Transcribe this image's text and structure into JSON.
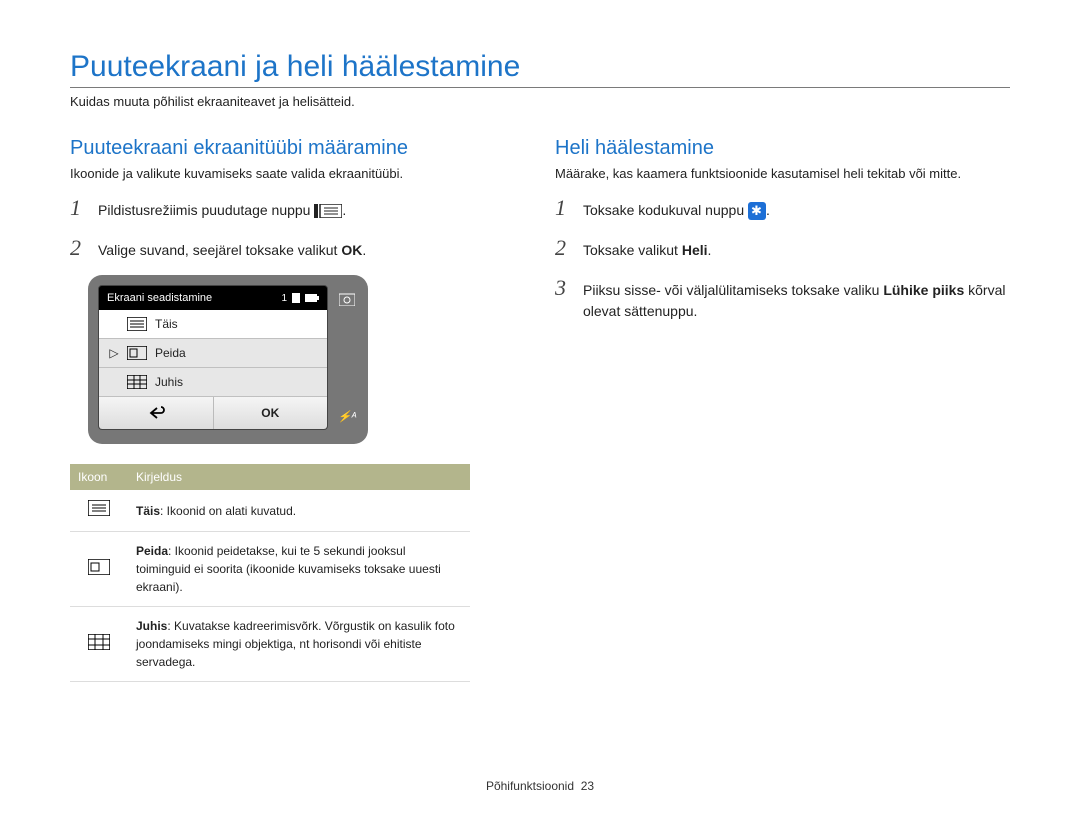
{
  "title": "Puuteekraani ja heli häälestamine",
  "subtitle": "Kuidas muuta põhilist ekraaniteavet ja helisätteid.",
  "left": {
    "heading": "Puuteekraani ekraanitüübi määramine",
    "lead": "Ikoonide ja valikute kuvamiseks saate valida ekraanitüübi.",
    "steps": {
      "s1": "Pildistusrežiimis puudutage nuppu ",
      "s1_after": ".",
      "s2": "Valige suvand, seejärel toksake valikut ",
      "s2_after": "."
    },
    "device": {
      "title": "Ekraani seadistamine",
      "status_num": "1",
      "items": {
        "i1": "Täis",
        "i2": "Peida",
        "i3": "Juhis"
      },
      "ok_label": "OK"
    },
    "table": {
      "h1": "Ikoon",
      "h2": "Kirjeldus",
      "r1_term": "Täis",
      "r1_body": ": Ikoonid on alati kuvatud.",
      "r2_term": "Peida",
      "r2_body": ": Ikoonid peidetakse, kui te 5 sekundi jooksul toiminguid ei soorita (ikoonide kuvamiseks toksake uuesti ekraani).",
      "r3_term": "Juhis",
      "r3_body": ": Kuvatakse kadreerimisvõrk. Võrgustik on kasulik foto joondamiseks mingi objektiga, nt horisondi või ehitiste servadega."
    }
  },
  "right": {
    "heading": "Heli häälestamine",
    "lead": "Määrake, kas kaamera funktsioonide kasutamisel heli tekitab või mitte.",
    "steps": {
      "s1": "Toksake kodukuval nuppu ",
      "s1_after": ".",
      "s2_pre": "Toksake valikut ",
      "s2_bold": "Heli",
      "s2_after": ".",
      "s3_pre": "Piiksu sisse- või väljalülitamiseks toksake valiku ",
      "s3_bold": "Lühike piiks",
      "s3_after": " kõrval olevat sättenuppu."
    }
  },
  "footer": {
    "label": "Põhifunktsioonid",
    "page_no": "23"
  },
  "ok_glyph": "OK",
  "flash_glyph": "⚡ᴬ"
}
